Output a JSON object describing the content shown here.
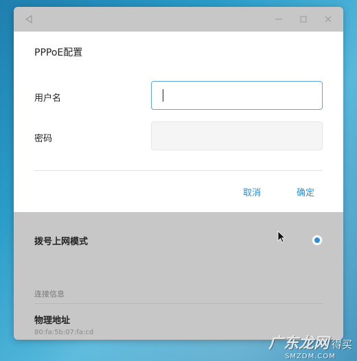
{
  "window": {
    "titlebar": {
      "back_icon": "back-triangle-icon",
      "min_icon": "minimize-icon",
      "max_icon": "maximize-icon",
      "close_icon": "close-icon"
    },
    "dial_mode_label": "拨号上网模式",
    "dial_mode_selected": true,
    "connection_section_header": "连接信息",
    "mac_label": "物理地址",
    "mac_value": "80:fa:5b:07:fa:cd"
  },
  "dialog": {
    "title": "PPPoE配置",
    "username_label": "用户名",
    "username_value": "",
    "password_label": "密码",
    "password_value": "",
    "cancel_label": "取消",
    "ok_label": "确定"
  },
  "watermark": {
    "brand": "广东龙网",
    "suffix": "得买",
    "domain": "SMZDM.COM"
  },
  "colors": {
    "accent": "#2c8dd9",
    "input_focus_border": "#5aa5e0",
    "dialog_bg": "#ffffff",
    "underlay_bg": "#c7c7c7"
  }
}
